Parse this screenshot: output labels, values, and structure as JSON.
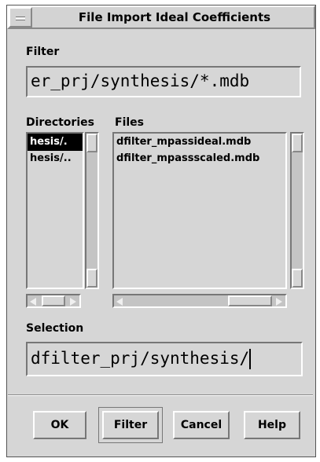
{
  "dialog": {
    "title": "File Import Ideal Coefficients"
  },
  "filter": {
    "label": "Filter",
    "value": "er_prj/synthesis/*.mdb"
  },
  "directories": {
    "label": "Directories",
    "items": [
      "hesis/.",
      "hesis/.."
    ],
    "selected_index": 0
  },
  "files": {
    "label": "Files",
    "items": [
      "dfilter_mpassideal.mdb",
      "dfilter_mpassscaled.mdb"
    ]
  },
  "selection": {
    "label": "Selection",
    "value": "dfilter_prj/synthesis/"
  },
  "buttons": {
    "ok": "OK",
    "filter": "Filter",
    "cancel": "Cancel",
    "help": "Help"
  }
}
